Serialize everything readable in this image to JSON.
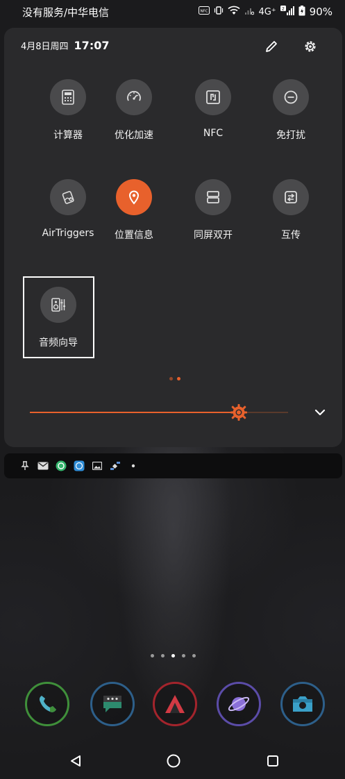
{
  "status_bar": {
    "carrier": "没有服务/中华电信",
    "network": "4G⁺",
    "battery": "90%"
  },
  "panel": {
    "date": "4月8日周四",
    "time": "17:07",
    "tiles": [
      {
        "label": "计算器",
        "icon": "calculator-icon",
        "active": false
      },
      {
        "label": "优化加速",
        "icon": "speedometer-icon",
        "active": false
      },
      {
        "label": "NFC",
        "icon": "nfc-icon",
        "active": false
      },
      {
        "label": "免打扰",
        "icon": "do-not-disturb-icon",
        "active": false
      },
      {
        "label": "AirTriggers",
        "icon": "airtriggers-icon",
        "active": false
      },
      {
        "label": "位置信息",
        "icon": "location-pin-icon",
        "active": true
      },
      {
        "label": "同屏双开",
        "icon": "split-screen-icon",
        "active": false
      },
      {
        "label": "互传",
        "icon": "transfer-icon",
        "active": false
      },
      {
        "label": "音频向导",
        "icon": "audio-wizard-icon",
        "active": false
      }
    ],
    "page_count": 2,
    "current_page": 2,
    "brightness": 0.81
  },
  "colors": {
    "accent": "#e8612c",
    "panel_bg": "#2a2a2c",
    "tile_bg": "#4a4a4c"
  },
  "dock": {
    "apps": [
      "phone-app-icon",
      "messages-app-icon",
      "rog-app-icon",
      "browser-app-icon",
      "camera-app-icon"
    ],
    "ring_colors": [
      "#3f8f3a",
      "#2d5f8a",
      "#a3242c",
      "#5b4ca8",
      "#2d5f8a"
    ]
  },
  "nav": {
    "buttons": [
      "back-button",
      "home-button",
      "recents-button"
    ]
  }
}
